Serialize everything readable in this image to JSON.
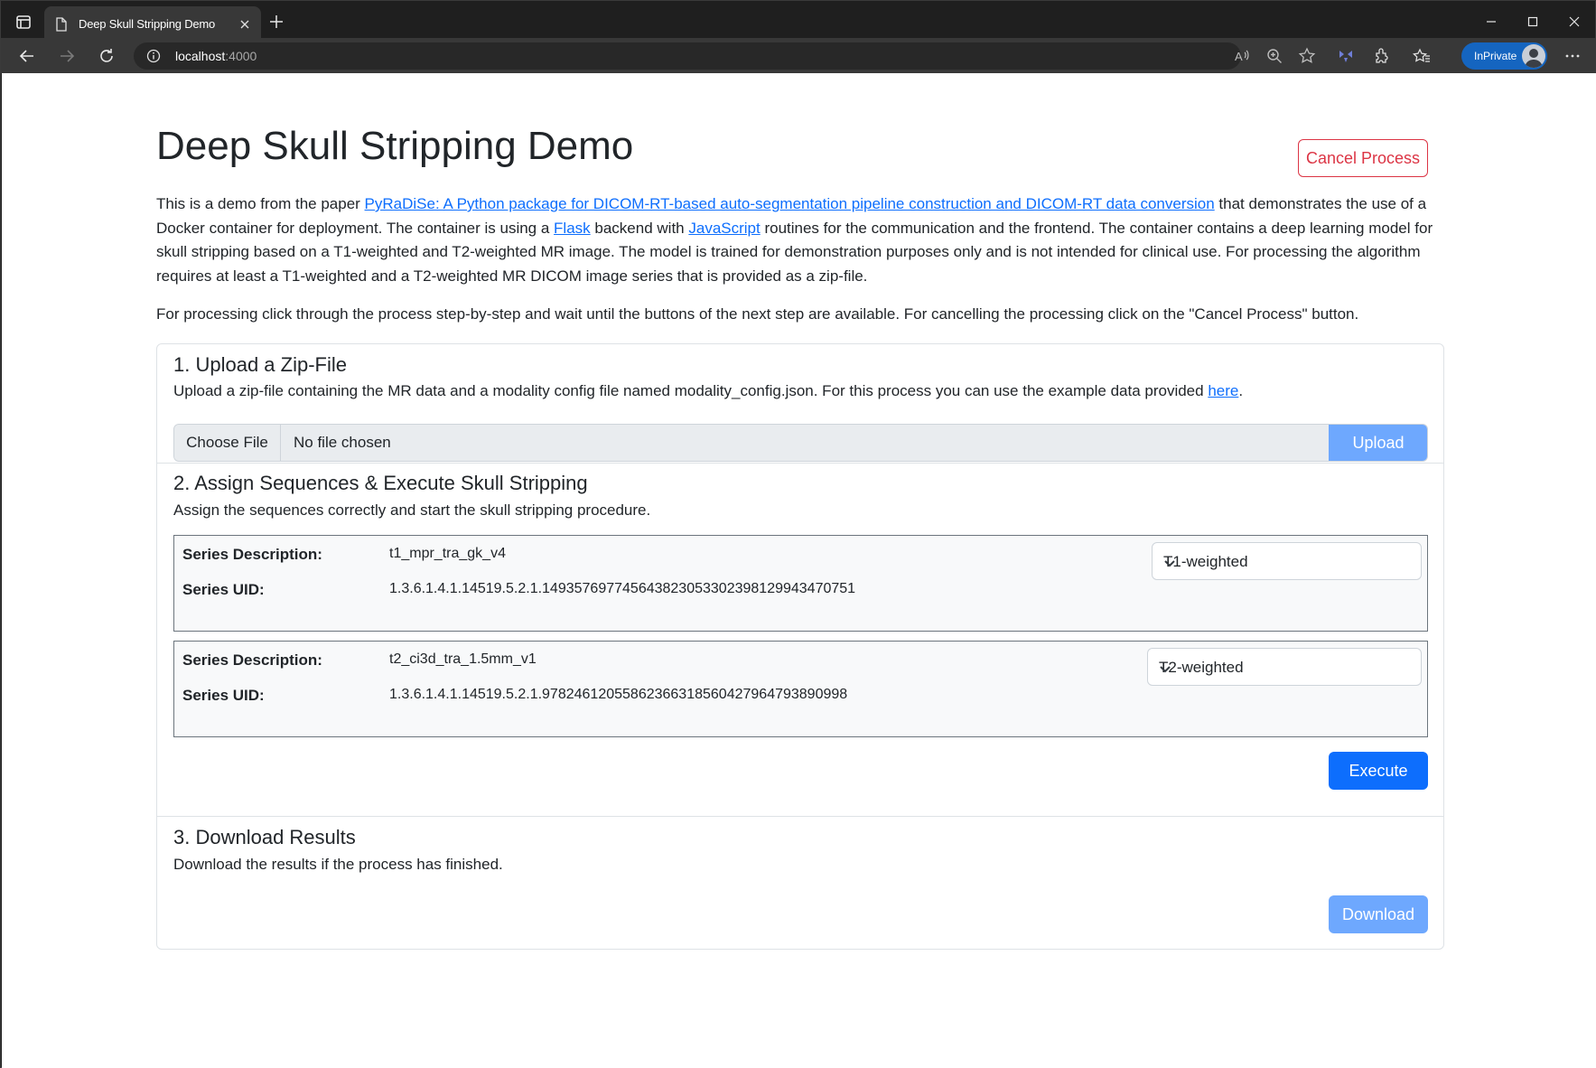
{
  "browser": {
    "tab_title": "Deep Skull Stripping Demo",
    "url_host": "localhost",
    "url_port": ":4000",
    "inprivate_label": "InPrivate"
  },
  "page": {
    "title": "Deep Skull Stripping Demo",
    "cancel_label": "Cancel Process",
    "intro": {
      "t1": "This is a demo from the paper ",
      "link_paper": "PyRaDiSe: A Python package for DICOM-RT-based auto-segmentation pipeline construction and DICOM-RT data conversion",
      "t2": " that demonstrates the use of a Docker container for deployment. The container is using a ",
      "link_flask": "Flask",
      "t3": " backend with ",
      "link_js": "JavaScript",
      "t4": " routines for the communication and the frontend. The container contains a deep learning model for skull stripping based on a T1-weighted and T2-weighted MR image. The model is trained for demonstration purposes only and is not intended for clinical use. For processing the algorithm requires at least a T1-weighted and a T2-weighted MR DICOM image series that is provided as a zip-file."
    },
    "intro2": "For processing click through the process step-by-step and wait until the buttons of the next step are available. For cancelling the processing click on the \"Cancel Process\" button."
  },
  "steps": {
    "upload": {
      "title": "1. Upload a Zip-File",
      "desc": "Upload a zip-file containing the MR data and a modality config file named modality_config.json. For this process you can use the example data provided ",
      "link_here": "here",
      "desc_end": ".",
      "choose_file": "Choose File",
      "no_file": "No file chosen",
      "upload_label": "Upload"
    },
    "assign": {
      "title": "2. Assign Sequences & Execute Skull Stripping",
      "desc": "Assign the sequences correctly and start the skull stripping procedure.",
      "desc_label": "Series Description:",
      "uid_label": "Series UID:",
      "series": [
        {
          "description": "t1_mpr_tra_gk_v4",
          "uid": "1.3.6.1.4.1.14519.5.2.1.149357697745643823053302398129943470751",
          "selected": "T1-weighted"
        },
        {
          "description": "t2_ci3d_tra_1.5mm_v1",
          "uid": "1.3.6.1.4.1.14519.5.2.1.97824612055862366318560427964793890998",
          "selected": "T2-weighted"
        }
      ],
      "execute_label": "Execute"
    },
    "download": {
      "title": "3. Download Results",
      "desc": "Download the results if the process has finished.",
      "download_label": "Download"
    }
  },
  "colors": {
    "primary": "#0d6efd",
    "primary_disabled": "#6ea8fe",
    "danger": "#dc3545",
    "inprivate": "#1565c0"
  }
}
